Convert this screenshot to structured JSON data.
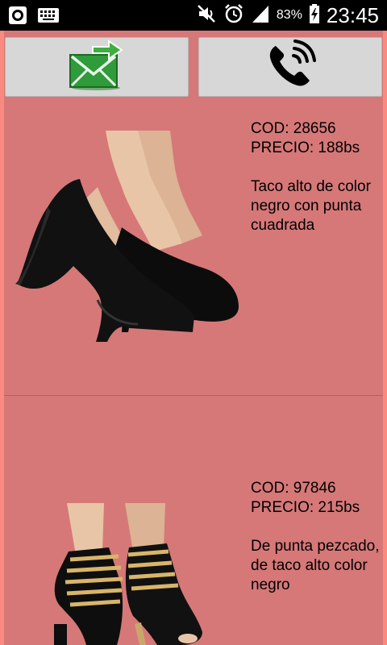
{
  "status_bar": {
    "battery": "83%",
    "time": "23:45"
  },
  "actions": {
    "email_icon": "email-forward-icon",
    "phone_icon": "phone-call-icon"
  },
  "products": [
    {
      "code_label": "COD: 28656",
      "price_label": "PRECIO: 188bs",
      "description": "Taco alto de color negro con punta cuadrada"
    },
    {
      "code_label": "COD: 97846",
      "price_label": "PRECIO: 215bs",
      "description": "De punta pezcado, de taco alto color negro"
    }
  ],
  "colors": {
    "frame": "#fa8a80",
    "list_background": "#d67878",
    "button_background": "#d7d7d7",
    "status_bar": "#000000"
  }
}
